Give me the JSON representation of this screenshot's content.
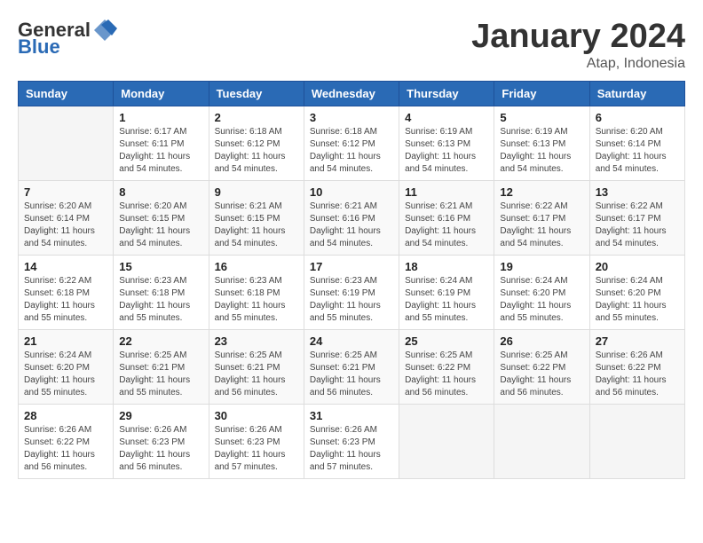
{
  "header": {
    "logo_general": "General",
    "logo_blue": "Blue",
    "month_title": "January 2024",
    "subtitle": "Atap, Indonesia"
  },
  "days_of_week": [
    "Sunday",
    "Monday",
    "Tuesday",
    "Wednesday",
    "Thursday",
    "Friday",
    "Saturday"
  ],
  "weeks": [
    [
      {
        "day": "",
        "info": ""
      },
      {
        "day": "1",
        "info": "Sunrise: 6:17 AM\nSunset: 6:11 PM\nDaylight: 11 hours\nand 54 minutes."
      },
      {
        "day": "2",
        "info": "Sunrise: 6:18 AM\nSunset: 6:12 PM\nDaylight: 11 hours\nand 54 minutes."
      },
      {
        "day": "3",
        "info": "Sunrise: 6:18 AM\nSunset: 6:12 PM\nDaylight: 11 hours\nand 54 minutes."
      },
      {
        "day": "4",
        "info": "Sunrise: 6:19 AM\nSunset: 6:13 PM\nDaylight: 11 hours\nand 54 minutes."
      },
      {
        "day": "5",
        "info": "Sunrise: 6:19 AM\nSunset: 6:13 PM\nDaylight: 11 hours\nand 54 minutes."
      },
      {
        "day": "6",
        "info": "Sunrise: 6:20 AM\nSunset: 6:14 PM\nDaylight: 11 hours\nand 54 minutes."
      }
    ],
    [
      {
        "day": "7",
        "info": "Sunrise: 6:20 AM\nSunset: 6:14 PM\nDaylight: 11 hours\nand 54 minutes."
      },
      {
        "day": "8",
        "info": "Sunrise: 6:20 AM\nSunset: 6:15 PM\nDaylight: 11 hours\nand 54 minutes."
      },
      {
        "day": "9",
        "info": "Sunrise: 6:21 AM\nSunset: 6:15 PM\nDaylight: 11 hours\nand 54 minutes."
      },
      {
        "day": "10",
        "info": "Sunrise: 6:21 AM\nSunset: 6:16 PM\nDaylight: 11 hours\nand 54 minutes."
      },
      {
        "day": "11",
        "info": "Sunrise: 6:21 AM\nSunset: 6:16 PM\nDaylight: 11 hours\nand 54 minutes."
      },
      {
        "day": "12",
        "info": "Sunrise: 6:22 AM\nSunset: 6:17 PM\nDaylight: 11 hours\nand 54 minutes."
      },
      {
        "day": "13",
        "info": "Sunrise: 6:22 AM\nSunset: 6:17 PM\nDaylight: 11 hours\nand 54 minutes."
      }
    ],
    [
      {
        "day": "14",
        "info": "Sunrise: 6:22 AM\nSunset: 6:18 PM\nDaylight: 11 hours\nand 55 minutes."
      },
      {
        "day": "15",
        "info": "Sunrise: 6:23 AM\nSunset: 6:18 PM\nDaylight: 11 hours\nand 55 minutes."
      },
      {
        "day": "16",
        "info": "Sunrise: 6:23 AM\nSunset: 6:18 PM\nDaylight: 11 hours\nand 55 minutes."
      },
      {
        "day": "17",
        "info": "Sunrise: 6:23 AM\nSunset: 6:19 PM\nDaylight: 11 hours\nand 55 minutes."
      },
      {
        "day": "18",
        "info": "Sunrise: 6:24 AM\nSunset: 6:19 PM\nDaylight: 11 hours\nand 55 minutes."
      },
      {
        "day": "19",
        "info": "Sunrise: 6:24 AM\nSunset: 6:20 PM\nDaylight: 11 hours\nand 55 minutes."
      },
      {
        "day": "20",
        "info": "Sunrise: 6:24 AM\nSunset: 6:20 PM\nDaylight: 11 hours\nand 55 minutes."
      }
    ],
    [
      {
        "day": "21",
        "info": "Sunrise: 6:24 AM\nSunset: 6:20 PM\nDaylight: 11 hours\nand 55 minutes."
      },
      {
        "day": "22",
        "info": "Sunrise: 6:25 AM\nSunset: 6:21 PM\nDaylight: 11 hours\nand 55 minutes."
      },
      {
        "day": "23",
        "info": "Sunrise: 6:25 AM\nSunset: 6:21 PM\nDaylight: 11 hours\nand 56 minutes."
      },
      {
        "day": "24",
        "info": "Sunrise: 6:25 AM\nSunset: 6:21 PM\nDaylight: 11 hours\nand 56 minutes."
      },
      {
        "day": "25",
        "info": "Sunrise: 6:25 AM\nSunset: 6:22 PM\nDaylight: 11 hours\nand 56 minutes."
      },
      {
        "day": "26",
        "info": "Sunrise: 6:25 AM\nSunset: 6:22 PM\nDaylight: 11 hours\nand 56 minutes."
      },
      {
        "day": "27",
        "info": "Sunrise: 6:26 AM\nSunset: 6:22 PM\nDaylight: 11 hours\nand 56 minutes."
      }
    ],
    [
      {
        "day": "28",
        "info": "Sunrise: 6:26 AM\nSunset: 6:22 PM\nDaylight: 11 hours\nand 56 minutes."
      },
      {
        "day": "29",
        "info": "Sunrise: 6:26 AM\nSunset: 6:23 PM\nDaylight: 11 hours\nand 56 minutes."
      },
      {
        "day": "30",
        "info": "Sunrise: 6:26 AM\nSunset: 6:23 PM\nDaylight: 11 hours\nand 57 minutes."
      },
      {
        "day": "31",
        "info": "Sunrise: 6:26 AM\nSunset: 6:23 PM\nDaylight: 11 hours\nand 57 minutes."
      },
      {
        "day": "",
        "info": ""
      },
      {
        "day": "",
        "info": ""
      },
      {
        "day": "",
        "info": ""
      }
    ]
  ]
}
